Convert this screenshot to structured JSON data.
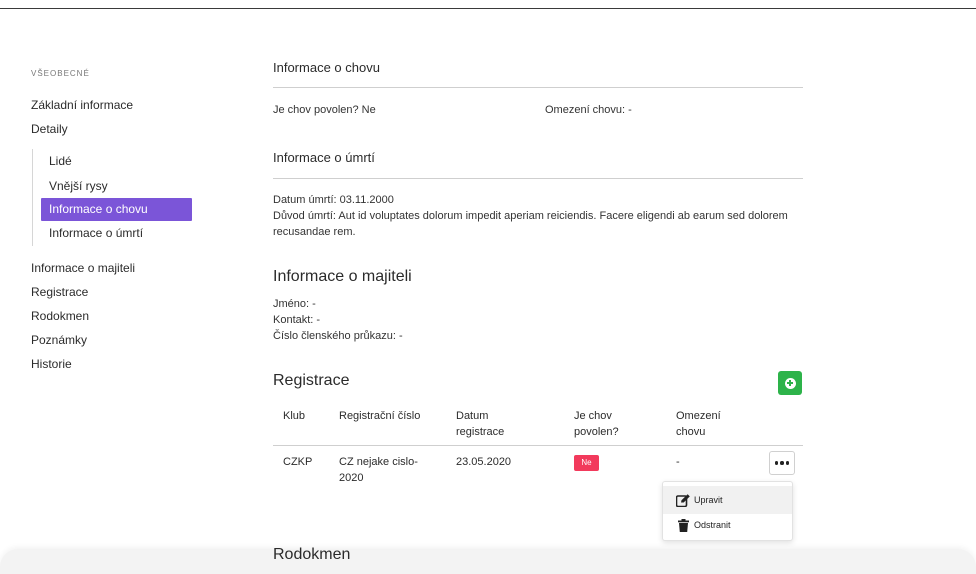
{
  "sidebar": {
    "section_label": "VŠEOBECNÉ",
    "items_top": [
      "Základní informace",
      "Detaily"
    ],
    "subitems": [
      "Lidé",
      "Vnější rysy",
      "Informace o chovu",
      "Informace o úmrtí"
    ],
    "active_subitem": "Informace o chovu",
    "items_bottom": [
      "Informace o majiteli",
      "Registrace",
      "Rodokmen",
      "Poznámky",
      "Historie"
    ]
  },
  "breeding": {
    "title": "Informace o chovu",
    "allowed": "Je chov povolen? Ne",
    "restriction": "Omezení chovu: -"
  },
  "death": {
    "title": "Informace o úmrtí",
    "date": "Datum úmrtí: 03.11.2000",
    "reason_line1": "Důvod úmrtí: Aut id voluptates dolorum impedit aperiam reiciendis. Facere eligendi ab earum sed dolorem",
    "reason_line2": "recusandae rem."
  },
  "owner": {
    "title": "Informace o majiteli",
    "name": "Jméno: -",
    "contact": "Kontakt: -",
    "card": "Číslo členského průkazu: -"
  },
  "registration": {
    "title": "Registrace",
    "headers": {
      "club": "Klub",
      "reg_no": "Registrační číslo",
      "date_1": "Datum",
      "date_2": "registrace",
      "allowed_1": "Je chov",
      "allowed_2": "povolen?",
      "restr_1": "Omezení",
      "restr_2": "chovu"
    },
    "row": {
      "club": "CZKP",
      "reg_no_1": "CZ nejake cislo-",
      "reg_no_2": "2020",
      "date": "23.05.2020",
      "allowed": "Ne",
      "restriction": "-"
    },
    "menu": {
      "edit": "Upravit",
      "delete": "Odstranit"
    }
  },
  "pedigree": {
    "title": "Rodokmen"
  },
  "colors": {
    "accent": "#7b55d8",
    "add": "#2db34a",
    "badge": "#f23a5c"
  }
}
